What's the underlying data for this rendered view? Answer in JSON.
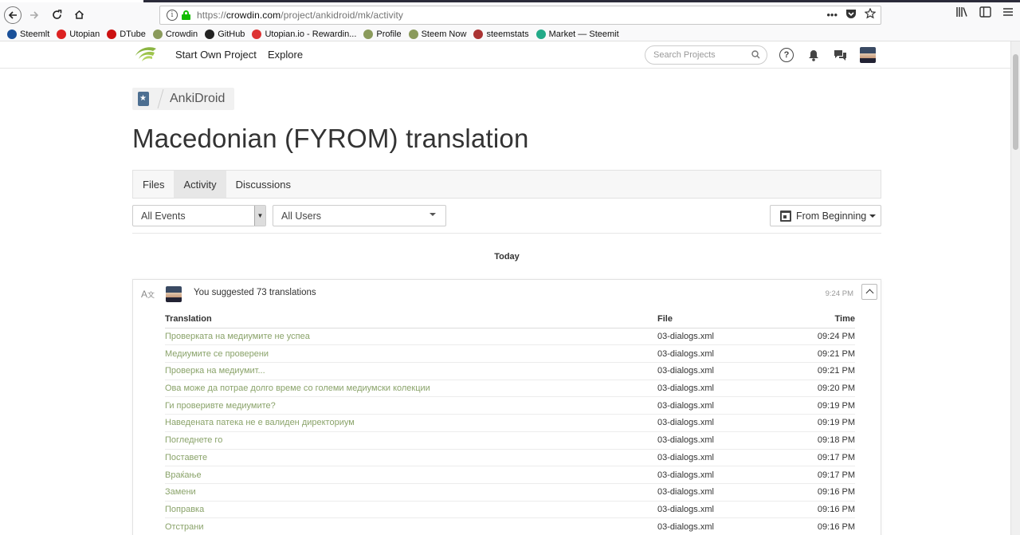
{
  "browser": {
    "url_prefix": "https://",
    "url_host": "crowdin.com",
    "url_path": "/project/ankidroid/mk/activity",
    "more_actions": "•••"
  },
  "bookmarks": [
    {
      "label": "Steemlt",
      "color": "#1a5099"
    },
    {
      "label": "Utopian",
      "color": "#d22"
    },
    {
      "label": "DTube",
      "color": "#c11"
    },
    {
      "label": "Crowdin",
      "color": "#8a9a5b"
    },
    {
      "label": "GitHub",
      "color": "#222"
    },
    {
      "label": "Utopian.io - Rewardin...",
      "color": "#d33"
    },
    {
      "label": "Profile",
      "color": "#8a9a5b"
    },
    {
      "label": "Steem Now",
      "color": "#8a9a5b"
    },
    {
      "label": "steemstats",
      "color": "#a33"
    },
    {
      "label": "Market — Steemit",
      "color": "#2a8"
    }
  ],
  "header": {
    "start_project": "Start Own Project",
    "explore": "Explore",
    "search_placeholder": "Search Projects"
  },
  "breadcrumb": {
    "project": "AnkiDroid"
  },
  "page": {
    "title": "Macedonian (FYROM) translation"
  },
  "tabs": [
    {
      "label": "Files",
      "active": false
    },
    {
      "label": "Activity",
      "active": true
    },
    {
      "label": "Discussions",
      "active": false
    }
  ],
  "filters": {
    "events": "All Events",
    "users": "All Users",
    "date": "From Beginning"
  },
  "activity": {
    "day": "Today",
    "summary": "You suggested 73 translations",
    "time": "9:24 PM",
    "columns": {
      "translation": "Translation",
      "file": "File",
      "time": "Time"
    },
    "rows": [
      {
        "translation": "Проверката на медиумите не успеа",
        "file": "03-dialogs.xml",
        "time": "09:24 PM"
      },
      {
        "translation": "Медиумите се проверени",
        "file": "03-dialogs.xml",
        "time": "09:21 PM"
      },
      {
        "translation": "Проверка на медиумит...",
        "file": "03-dialogs.xml",
        "time": "09:21 PM"
      },
      {
        "translation": "Ова може да потрае долго време со големи медиумски колекции",
        "file": "03-dialogs.xml",
        "time": "09:20 PM"
      },
      {
        "translation": "Ги проверивте медиумите?",
        "file": "03-dialogs.xml",
        "time": "09:19 PM"
      },
      {
        "translation": "Наведената патека не е валиден директориум",
        "file": "03-dialogs.xml",
        "time": "09:19 PM"
      },
      {
        "translation": "Погледнете го",
        "file": "03-dialogs.xml",
        "time": "09:18 PM"
      },
      {
        "translation": "Поставете",
        "file": "03-dialogs.xml",
        "time": "09:17 PM"
      },
      {
        "translation": "Враќање",
        "file": "03-dialogs.xml",
        "time": "09:17 PM"
      },
      {
        "translation": "Замени",
        "file": "03-dialogs.xml",
        "time": "09:16 PM"
      },
      {
        "translation": "Поправка",
        "file": "03-dialogs.xml",
        "time": "09:16 PM"
      },
      {
        "translation": "Отстрани",
        "file": "03-dialogs.xml",
        "time": "09:16 PM"
      }
    ]
  }
}
